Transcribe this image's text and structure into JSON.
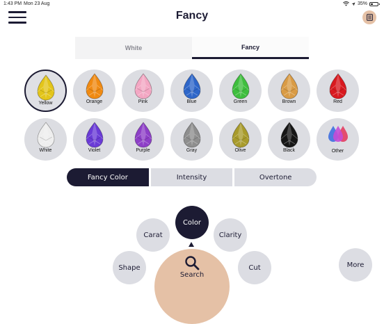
{
  "status_bar": {
    "time": "1:43 PM",
    "date": "Mon 23 Aug",
    "battery": "35%",
    "battery_level": 0.35
  },
  "header": {
    "title": "Fancy"
  },
  "type_tabs": [
    {
      "label": "White",
      "active": false
    },
    {
      "label": "Fancy",
      "active": true
    }
  ],
  "colors": [
    {
      "label": "Yellow",
      "color": "#e3c51a",
      "selected": true
    },
    {
      "label": "Orange",
      "color": "#f08a12",
      "selected": false
    },
    {
      "label": "Pink",
      "color": "#f3a7c3",
      "selected": false
    },
    {
      "label": "Blue",
      "color": "#2e66c9",
      "selected": false
    },
    {
      "label": "Green",
      "color": "#3fbe3e",
      "selected": false
    },
    {
      "label": "Brown",
      "color": "#d99b45",
      "selected": false
    },
    {
      "label": "Red",
      "color": "#d8191f",
      "selected": false
    },
    {
      "label": "White",
      "color": "#eeeeee",
      "selected": false
    },
    {
      "label": "Violet",
      "color": "#6a3bd6",
      "selected": false
    },
    {
      "label": "Purple",
      "color": "#8d3fc7",
      "selected": false
    },
    {
      "label": "Gray",
      "color": "#8e8e8e",
      "selected": false
    },
    {
      "label": "Olive",
      "color": "#a89b2c",
      "selected": false
    },
    {
      "label": "Black",
      "color": "#161616",
      "selected": false
    },
    {
      "label": "Other",
      "color": "#c43d8e",
      "selected": false
    }
  ],
  "other_drop_colors": [
    "#3f6fe0",
    "#c44bd6",
    "#e33d62"
  ],
  "sub_tabs": [
    {
      "label": "Fancy Color",
      "active": true
    },
    {
      "label": "Intensity",
      "active": false
    },
    {
      "label": "Overtone",
      "active": false
    }
  ],
  "radial_menu": {
    "shape": "Shape",
    "carat": "Carat",
    "color": "Color",
    "clarity": "Clarity",
    "cut": "Cut",
    "more": "More",
    "search": "Search",
    "active": "color"
  },
  "theme": {
    "navy": "#1c1b33",
    "accent": "#e5c1a6",
    "button_gray": "#dcdde3"
  }
}
